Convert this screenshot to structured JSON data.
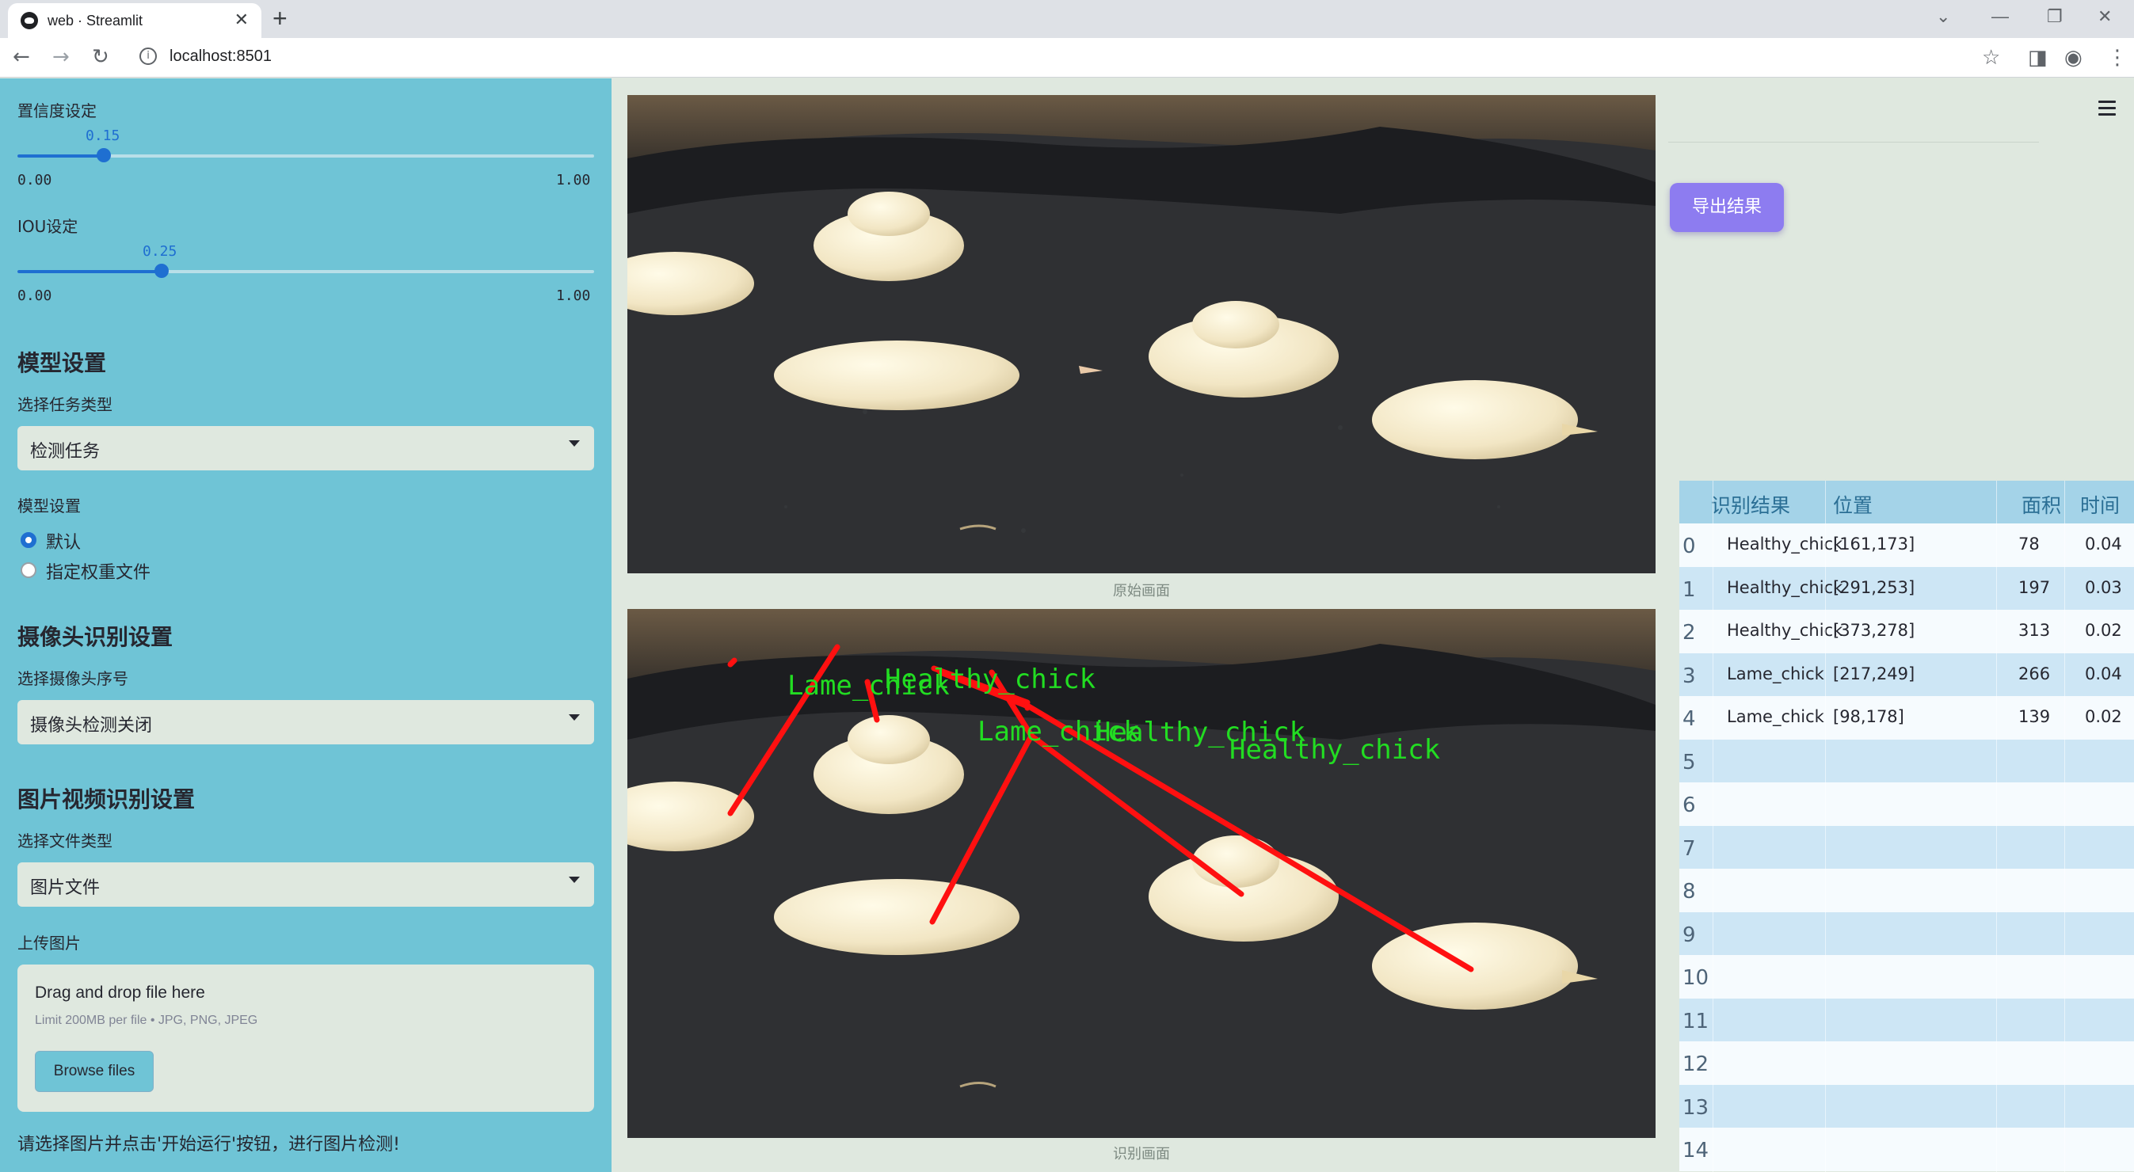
{
  "browser": {
    "tab_title": "web · Streamlit",
    "url": "localhost:8501"
  },
  "sidebar": {
    "confidence": {
      "label": "置信度设定",
      "value": "0.15",
      "min": "0.00",
      "max": "1.00",
      "fraction": 0.15
    },
    "iou": {
      "label": "IOU设定",
      "value": "0.25",
      "min": "0.00",
      "max": "1.00",
      "fraction": 0.25
    },
    "model_heading": "模型设置",
    "task_label": "选择任务类型",
    "task_value": "检测任务",
    "model_label": "模型设置",
    "radio_default": "默认",
    "radio_custom": "指定权重文件",
    "camera_heading": "摄像头识别设置",
    "camera_label": "选择摄像头序号",
    "camera_value": "摄像头检测关闭",
    "media_heading": "图片视频识别设置",
    "filetype_label": "选择文件类型",
    "filetype_value": "图片文件",
    "upload_label": "上传图片",
    "upload_title": "Drag and drop file here",
    "upload_limit": "Limit 200MB per file • JPG, PNG, JPEG",
    "browse_label": "Browse files",
    "hint": "请选择图片并点击'开始运行'按钮，进行图片检测!"
  },
  "main": {
    "caption_original": "原始画面",
    "caption_detected": "识别画面",
    "export_label": "导出结果",
    "detection_labels": [
      "Lame_chick",
      "Healthy_chick",
      "Lame_chick",
      "Healthy_chick",
      "Healthy_chick"
    ],
    "table": {
      "headers": [
        "识别结果",
        "位置",
        "面积",
        "时间"
      ],
      "rows": [
        {
          "idx": "0",
          "result": "Healthy_chick",
          "pos": "[161,173]",
          "area": "78",
          "time": "0.04"
        },
        {
          "idx": "1",
          "result": "Healthy_chick",
          "pos": "[291,253]",
          "area": "197",
          "time": "0.03"
        },
        {
          "idx": "2",
          "result": "Healthy_chick",
          "pos": "[373,278]",
          "area": "313",
          "time": "0.02"
        },
        {
          "idx": "3",
          "result": "Lame_chick",
          "pos": "[217,249]",
          "area": "266",
          "time": "0.04"
        },
        {
          "idx": "4",
          "result": "Lame_chick",
          "pos": "[98,178]",
          "area": "139",
          "time": "0.02"
        },
        {
          "idx": "5",
          "result": "",
          "pos": "",
          "area": "",
          "time": ""
        },
        {
          "idx": "6",
          "result": "",
          "pos": "",
          "area": "",
          "time": ""
        },
        {
          "idx": "7",
          "result": "",
          "pos": "",
          "area": "",
          "time": ""
        },
        {
          "idx": "8",
          "result": "",
          "pos": "",
          "area": "",
          "time": ""
        },
        {
          "idx": "9",
          "result": "",
          "pos": "",
          "area": "",
          "time": ""
        },
        {
          "idx": "10",
          "result": "",
          "pos": "",
          "area": "",
          "time": ""
        },
        {
          "idx": "11",
          "result": "",
          "pos": "",
          "area": "",
          "time": ""
        },
        {
          "idx": "12",
          "result": "",
          "pos": "",
          "area": "",
          "time": ""
        },
        {
          "idx": "13",
          "result": "",
          "pos": "",
          "area": "",
          "time": ""
        },
        {
          "idx": "14",
          "result": "",
          "pos": "",
          "area": "",
          "time": ""
        }
      ]
    }
  }
}
